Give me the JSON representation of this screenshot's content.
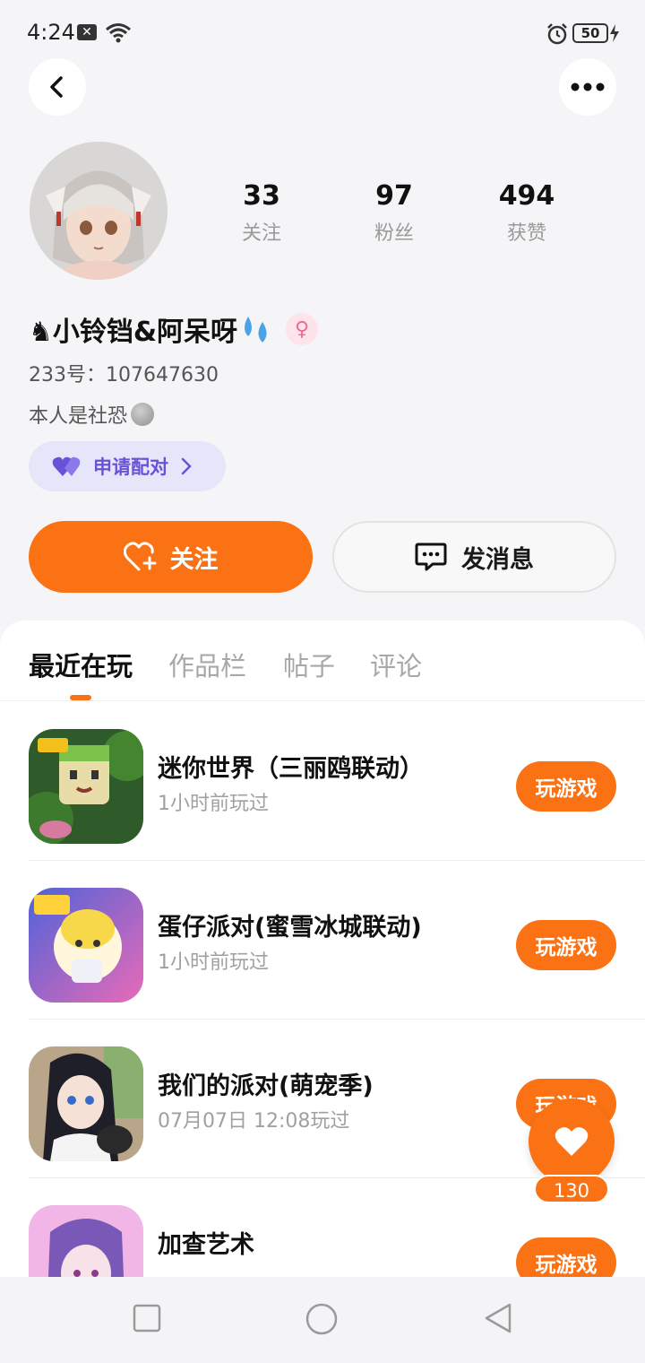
{
  "status_bar": {
    "time": "4:24",
    "notification_glyph": "✕",
    "battery_level": "50",
    "icons": [
      "wifi-icon",
      "alarm-icon",
      "battery-icon",
      "charging-icon"
    ]
  },
  "nav": {
    "back_icon": "chevron-left-icon",
    "more_icon": "more-horizontal-icon"
  },
  "profile": {
    "stats": [
      {
        "value": "33",
        "label": "关注"
      },
      {
        "value": "97",
        "label": "粉丝"
      },
      {
        "value": "494",
        "label": "获赞"
      }
    ],
    "nickname": "♞小铃铛&阿呆呀",
    "gender_symbol": "♀",
    "uid": "233号：107647630",
    "bio": "本人是社恐"
  },
  "match_button": {
    "label": "申请配对",
    "icon": "heart-pair-icon"
  },
  "actions": {
    "follow_label": "关注",
    "message_label": "发消息"
  },
  "tabs": [
    {
      "label": "最近在玩",
      "active": true
    },
    {
      "label": "作品栏",
      "active": false
    },
    {
      "label": "帖子",
      "active": false
    },
    {
      "label": "评论",
      "active": false
    }
  ],
  "games": [
    {
      "title": "迷你世界（三丽鸥联动）",
      "subtitle": "1小时前玩过",
      "button": "玩游戏"
    },
    {
      "title": "蛋仔派对(蜜雪冰城联动)",
      "subtitle": "1小时前玩过",
      "button": "玩游戏"
    },
    {
      "title": "我们的派对(萌宠季)",
      "subtitle": "07月07日 12:08玩过",
      "button": "玩游戏"
    },
    {
      "title": "加查艺术",
      "subtitle": "",
      "button": "玩游戏"
    }
  ],
  "floating_like": {
    "count": "130"
  },
  "colors": {
    "accent": "#fa7214",
    "match_text": "#6a52d8",
    "match_bg": "#e6e6fa",
    "page_bg": "#f5f5f7"
  }
}
